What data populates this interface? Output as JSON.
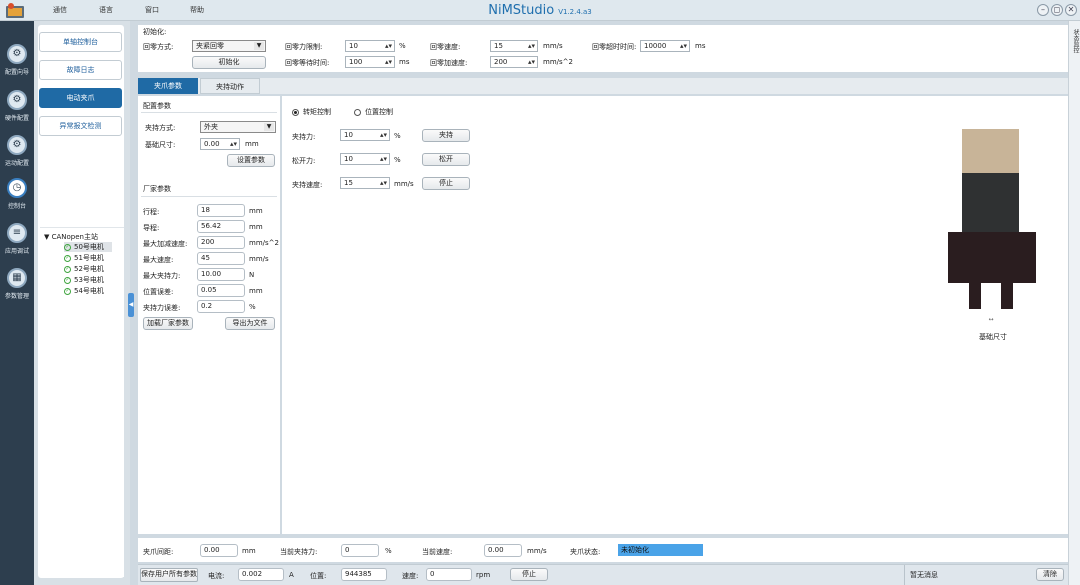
{
  "app": {
    "title": "NiMStudio",
    "version": "V1.2.4.a3"
  },
  "menu": [
    "通信",
    "语言",
    "窗口",
    "帮助"
  ],
  "window_controls": {
    "minimize": "–",
    "restore": "◻",
    "close": "✕"
  },
  "leftbar": [
    {
      "label": "配置向导",
      "icon": "wizard-icon",
      "glyph": "⚙"
    },
    {
      "label": "硬件配置",
      "icon": "hardware-icon",
      "glyph": "⚙"
    },
    {
      "label": "运动配置",
      "icon": "motion-icon",
      "glyph": "⚙"
    },
    {
      "label": "控制台",
      "icon": "console-icon",
      "glyph": "◷"
    },
    {
      "label": "应用调试",
      "icon": "debug-icon",
      "glyph": "≡"
    },
    {
      "label": "参数管理",
      "icon": "params-icon",
      "glyph": "▦"
    }
  ],
  "nav": [
    "单轴控制台",
    "故障日志",
    "电动夹爪",
    "异常报文检测"
  ],
  "tree": {
    "root": "CANopen主站",
    "children": [
      "50号电机",
      "51号电机",
      "52号电机",
      "53号电机",
      "54号电机"
    ]
  },
  "right_strip": "状态监控",
  "init": {
    "section": "初始化:",
    "home_mode_label": "回零方式:",
    "home_mode_value": "夹紧回零",
    "init_button": "初始化",
    "home_force_label": "回零力限制:",
    "home_force_value": "10",
    "home_force_unit": "%",
    "home_wait_label": "回零等待时间:",
    "home_wait_value": "100",
    "home_wait_unit": "ms",
    "home_speed_label": "回零速度:",
    "home_speed_value": "15",
    "home_speed_unit": "mm/s",
    "home_accel_label": "回零加速度:",
    "home_accel_value": "200",
    "home_accel_unit": "mm/s^2",
    "home_timeout_label": "回零超时时间:",
    "home_timeout_value": "10000",
    "home_timeout_unit": "ms"
  },
  "tabs": [
    "夹爪参数",
    "夹持动作"
  ],
  "config": {
    "title": "配置参数",
    "clamp_mode_label": "夹持方式:",
    "clamp_mode_value": "外夹",
    "base_size_label": "基础尺寸:",
    "base_size_value": "0.00",
    "base_size_unit": "mm",
    "set_button": "设置参数",
    "vendor_title": "厂家参数",
    "vendor_params": [
      {
        "label": "行程:",
        "value": "18",
        "unit": "mm"
      },
      {
        "label": "导程:",
        "value": "56.42",
        "unit": "mm"
      },
      {
        "label": "最大加减速度:",
        "value": "200",
        "unit": "mm/s^2"
      },
      {
        "label": "最大速度:",
        "value": "45",
        "unit": "mm/s"
      },
      {
        "label": "最大夹持力:",
        "value": "10.00",
        "unit": "N"
      },
      {
        "label": "位置误差:",
        "value": "0.05",
        "unit": "mm"
      },
      {
        "label": "夹持力误差:",
        "value": "0.2",
        "unit": "%"
      }
    ],
    "load_button": "加载厂家参数",
    "export_button": "导出为文件"
  },
  "control": {
    "torque_mode": "转矩控制",
    "position_mode": "位置控制",
    "clamp_force_label": "夹持力:",
    "clamp_force_value": "10",
    "clamp_force_unit": "%",
    "clamp_button": "夹持",
    "release_force_label": "松开力:",
    "release_force_value": "10",
    "release_force_unit": "%",
    "release_button": "松开",
    "clamp_speed_label": "夹持速度:",
    "clamp_speed_value": "15",
    "clamp_speed_unit": "mm/s",
    "stop_button": "停止"
  },
  "diagram": {
    "base_size_label": "基础尺寸",
    "colors": {
      "top": "#c8b498",
      "middle": "#2f3132",
      "body": "#2a1d1f"
    }
  },
  "status_row": {
    "spacing_label": "夹爪间距:",
    "spacing_value": "0.00",
    "spacing_unit": "mm",
    "force_label": "当前夹持力:",
    "force_value": "0",
    "force_unit": "%",
    "speed_label": "当前速度:",
    "speed_value": "0.00",
    "speed_unit": "mm/s",
    "state_label": "夹爪状态:",
    "state_value": "未初始化"
  },
  "bottom": {
    "save_button": "保存用户所有参数",
    "current_label": "电流:",
    "current_value": "0.002",
    "current_unit": "A",
    "position_label": "位置:",
    "position_value": "944385",
    "speed_label": "速度:",
    "speed_value": "0",
    "speed_unit": "rpm",
    "stop_button": "停止",
    "message": "暂无消息",
    "clear_button": "清除"
  },
  "colors": {
    "accent": "#1f6aa5",
    "state_bg": "#4aa3e8",
    "leftbar": "#2d3e4e"
  }
}
